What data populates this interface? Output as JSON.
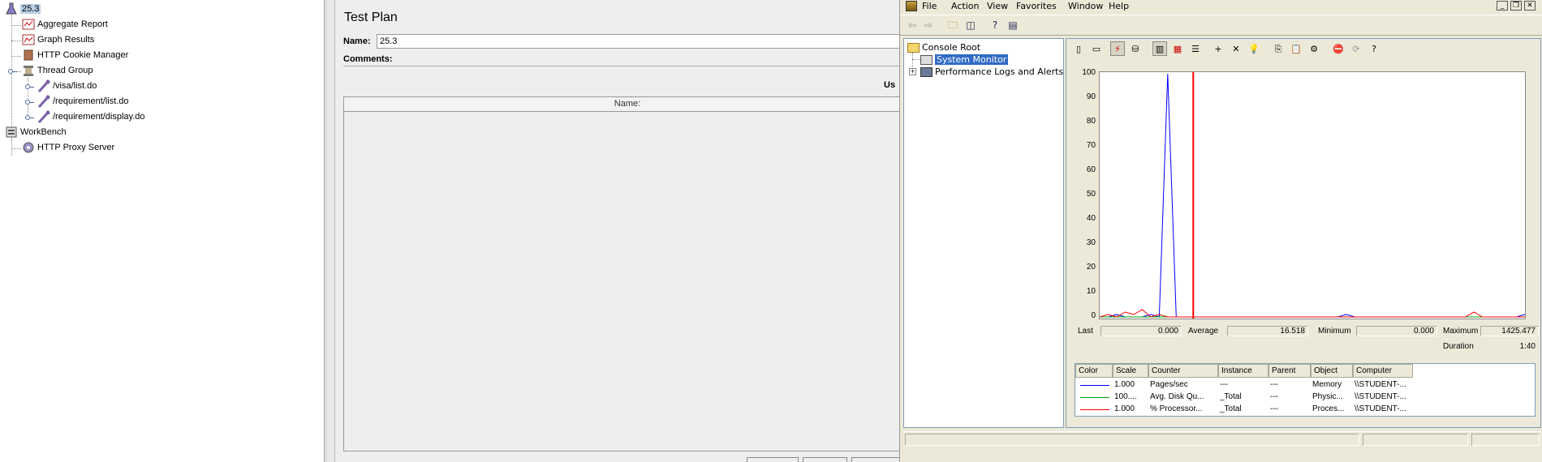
{
  "jmeter": {
    "tree": [
      {
        "label": "25.3",
        "icon": "flask-icon"
      },
      {
        "label": "Aggregate Report",
        "icon": "report-icon"
      },
      {
        "label": "Graph Results",
        "icon": "graph-icon"
      },
      {
        "label": "HTTP Cookie Manager",
        "icon": "cookie-icon"
      },
      {
        "label": "Thread Group",
        "icon": "spool-icon"
      },
      {
        "label": "/visa/list.do",
        "icon": "sampler-icon"
      },
      {
        "label": "/requirement/list.do",
        "icon": "sampler-icon"
      },
      {
        "label": "/requirement/display.do",
        "icon": "sampler-icon"
      },
      {
        "label": "WorkBench",
        "icon": "workbench-icon"
      },
      {
        "label": "HTTP Proxy Server",
        "icon": "gear-icon"
      }
    ],
    "plan": {
      "title": "Test Plan",
      "name_label": "Name:",
      "name_value": "25.3",
      "comments_label": "Comments:",
      "user_vars_label": "Us",
      "table_header": "Name:"
    }
  },
  "mmc": {
    "menu": [
      "File",
      "Action",
      "View",
      "Favorites",
      "Window",
      "Help"
    ],
    "scope_tree": {
      "root": "Console Root",
      "items": [
        "System Monitor",
        "Performance Logs and Alerts"
      ]
    },
    "stats": {
      "last_label": "Last",
      "last_value": "0.000",
      "average_label": "Average",
      "average_value": "16.518",
      "minimum_label": "Minimum",
      "minimum_value": "0.000",
      "maximum_label": "Maximum",
      "maximum_value": "1425.477",
      "duration_label": "Duration",
      "duration_value": "1:40"
    },
    "legend": {
      "columns": [
        "Color",
        "Scale",
        "Counter",
        "Instance",
        "Parent",
        "Object",
        "Computer"
      ],
      "rows": [
        {
          "color": "#0000ff",
          "scale": "1.000",
          "counter": "Pages/sec",
          "instance": "---",
          "parent": "---",
          "object": "Memory",
          "computer": "\\\\STUDENT-..."
        },
        {
          "color": "#00a000",
          "scale": "100....",
          "counter": "Avg. Disk Qu...",
          "instance": "_Total",
          "parent": "---",
          "object": "Physic...",
          "computer": "\\\\STUDENT-..."
        },
        {
          "color": "#ff0000",
          "scale": "1.000",
          "counter": "% Processor...",
          "instance": "_Total",
          "parent": "---",
          "object": "Proces...",
          "computer": "\\\\STUDENT-..."
        }
      ]
    },
    "chart_data": {
      "type": "line",
      "ylim": [
        0,
        100
      ],
      "yticks": [
        100,
        90,
        80,
        70,
        60,
        50,
        40,
        30,
        20,
        10,
        0
      ],
      "x": [
        0,
        2,
        4,
        6,
        8,
        10,
        12,
        14,
        16,
        18,
        20,
        22,
        24,
        26,
        28,
        30,
        32,
        34,
        36,
        38,
        40,
        42,
        44,
        46,
        48,
        50,
        52,
        54,
        56,
        58,
        60,
        62,
        64,
        66,
        68,
        70,
        72,
        74,
        76,
        78,
        80,
        82,
        84,
        86,
        88,
        90,
        92,
        94,
        96,
        98,
        100
      ],
      "series": [
        {
          "name": "Pages/sec",
          "color": "#0000ff",
          "values": [
            0,
            0,
            1,
            0,
            0,
            0,
            1,
            0,
            100,
            0,
            0,
            0,
            0,
            0,
            0,
            0,
            0,
            0,
            0,
            0,
            0,
            0,
            0,
            0,
            0,
            0,
            0,
            0,
            0,
            1,
            0,
            0,
            0,
            0,
            0,
            0,
            0,
            0,
            0,
            0,
            0,
            0,
            0,
            0,
            0,
            0,
            0,
            0,
            0,
            0,
            1
          ]
        },
        {
          "name": "Avg. Disk Qu...",
          "color": "#00a000",
          "values": [
            0,
            0,
            0,
            0,
            0,
            0,
            0,
            0,
            0,
            0,
            0,
            0,
            0,
            0,
            0,
            0,
            0,
            0,
            0,
            0,
            0,
            0,
            0,
            0,
            0,
            0,
            0,
            0,
            0,
            0,
            0,
            0,
            0,
            0,
            0,
            0,
            0,
            0,
            0,
            0,
            0,
            0,
            0,
            0,
            0,
            0,
            0,
            0,
            0,
            0,
            0
          ]
        },
        {
          "name": "% Processor...",
          "color": "#ff0000",
          "values": [
            0,
            1,
            0,
            2,
            1,
            3,
            0,
            1,
            0,
            0,
            0,
            0,
            0,
            0,
            0,
            0,
            0,
            0,
            0,
            0,
            0,
            0,
            0,
            0,
            0,
            0,
            0,
            0,
            0,
            0,
            0,
            0,
            0,
            0,
            0,
            0,
            0,
            0,
            0,
            0,
            0,
            0,
            0,
            0,
            2,
            0,
            0,
            0,
            0,
            0,
            0
          ]
        }
      ]
    }
  }
}
